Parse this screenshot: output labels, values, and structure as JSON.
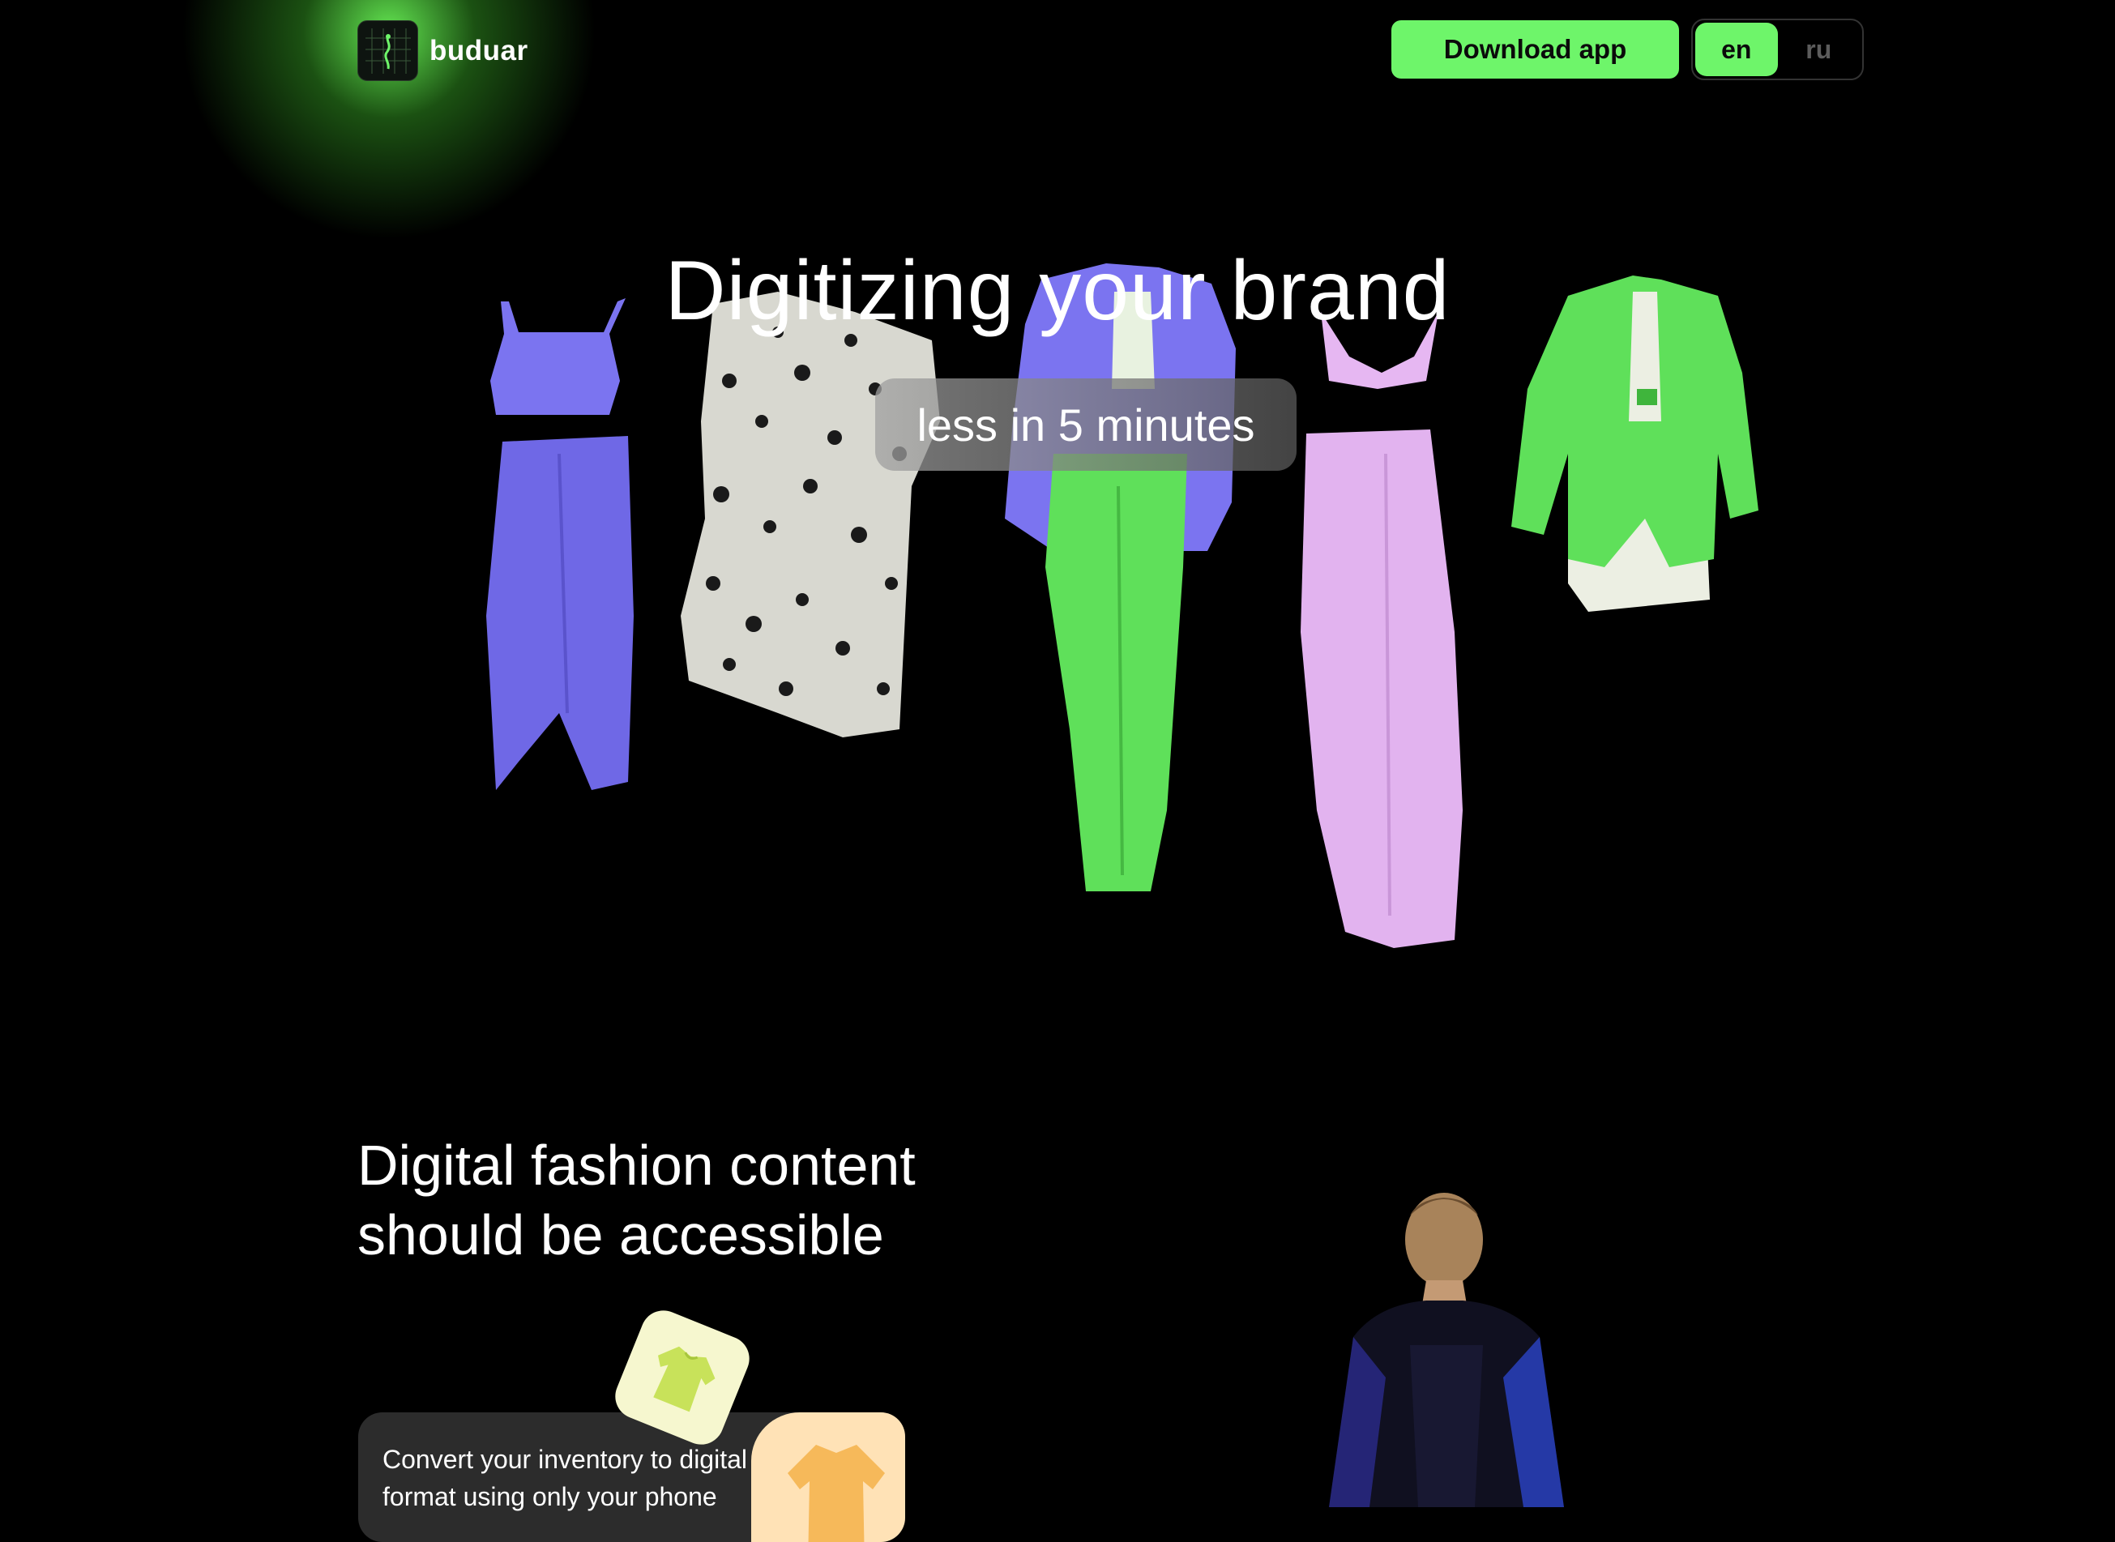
{
  "header": {
    "brand": "buduar",
    "download_label": "Download app",
    "languages": [
      {
        "code": "en",
        "active": true
      },
      {
        "code": "ru",
        "active": false
      }
    ]
  },
  "hero": {
    "title": "Digitizing your brand",
    "subtitle": "less in 5 minutes",
    "garments": [
      "purple-top-and-skirt",
      "leopard-dress",
      "purple-blazer-green-pants",
      "pink-bralette-and-pants",
      "green-blazer-white-skirt"
    ]
  },
  "section": {
    "title": "Digital fashion content should be accessible",
    "card_text": "Convert your inventory to digital format using only your phone"
  },
  "colors": {
    "accent": "#6ef56a",
    "background": "#000000",
    "purple": "#7b74f0",
    "green": "#5fe05a",
    "pink": "#e6b7f2",
    "card": "#2c2c2c"
  }
}
